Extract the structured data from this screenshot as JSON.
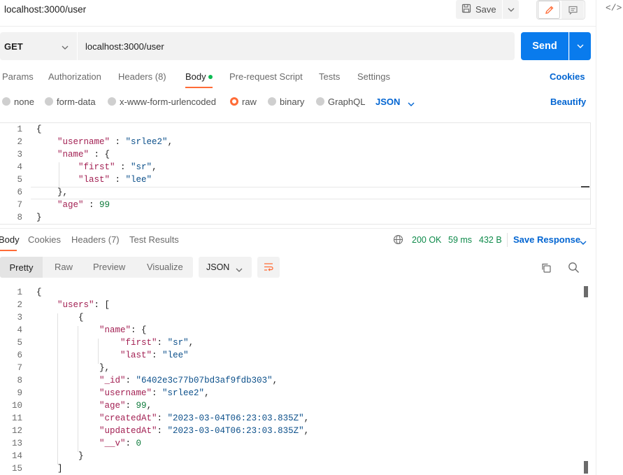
{
  "window": {
    "title": "localhost:3000/user",
    "code_toggle": "</>"
  },
  "toolbar": {
    "save_label": "Save"
  },
  "request": {
    "method": "GET",
    "url": "localhost:3000/user",
    "send_label": "Send"
  },
  "request_tabs": {
    "params": "Params",
    "authorization": "Authorization",
    "headers": "Headers (8)",
    "body": "Body",
    "prerequest": "Pre-request Script",
    "tests": "Tests",
    "settings": "Settings",
    "cookies": "Cookies"
  },
  "body_types": {
    "none": "none",
    "form_data": "form-data",
    "urlencoded": "x-www-form-urlencoded",
    "raw": "raw",
    "binary": "binary",
    "graphql": "GraphQL",
    "format": "JSON",
    "beautify": "Beautify",
    "selected": "raw"
  },
  "request_body": {
    "line_numbers": [
      "1",
      "2",
      "3",
      "4",
      "5",
      "6",
      "7",
      "8"
    ],
    "lines": [
      "{",
      "    \"username\" : \"srlee2\",",
      "    \"name\" : {",
      "        \"first\" : \"sr\",",
      "        \"last\" : \"lee\"",
      "    },",
      "    \"age\" : 99",
      "}"
    ]
  },
  "response_tabs": {
    "body": "Body",
    "cookies": "Cookies",
    "headers": "Headers (7)",
    "test_results": "Test Results"
  },
  "response_meta": {
    "status": "200 OK",
    "time": "59 ms",
    "size": "432 B",
    "save_response": "Save Response"
  },
  "view_modes": {
    "pretty": "Pretty",
    "raw": "Raw",
    "preview": "Preview",
    "visualize": "Visualize",
    "format": "JSON"
  },
  "response_body": {
    "line_numbers": [
      "1",
      "2",
      "3",
      "4",
      "5",
      "6",
      "7",
      "8",
      "9",
      "10",
      "11",
      "12",
      "13",
      "14",
      "15"
    ],
    "lines": [
      "{",
      "    \"users\": [",
      "        {",
      "            \"name\": {",
      "                \"first\": \"sr\",",
      "                \"last\": \"lee\"",
      "            },",
      "            \"_id\": \"6402e3c77b07bd3af9fdb303\",",
      "            \"username\": \"srlee2\",",
      "            \"age\": 99,",
      "            \"createdAt\": \"2023-03-04T06:23:03.835Z\",",
      "            \"updatedAt\": \"2023-03-04T06:23:03.835Z\",",
      "            \"__v\": 0",
      "        }",
      "    ]"
    ]
  },
  "colors": {
    "accent": "#ff6c37",
    "primary": "#097bed",
    "link": "#0265d2",
    "success": "#0e8a4a",
    "json_key": "#a21f52",
    "json_string": "#0b4f8a",
    "json_number": "#0e7a3b"
  }
}
